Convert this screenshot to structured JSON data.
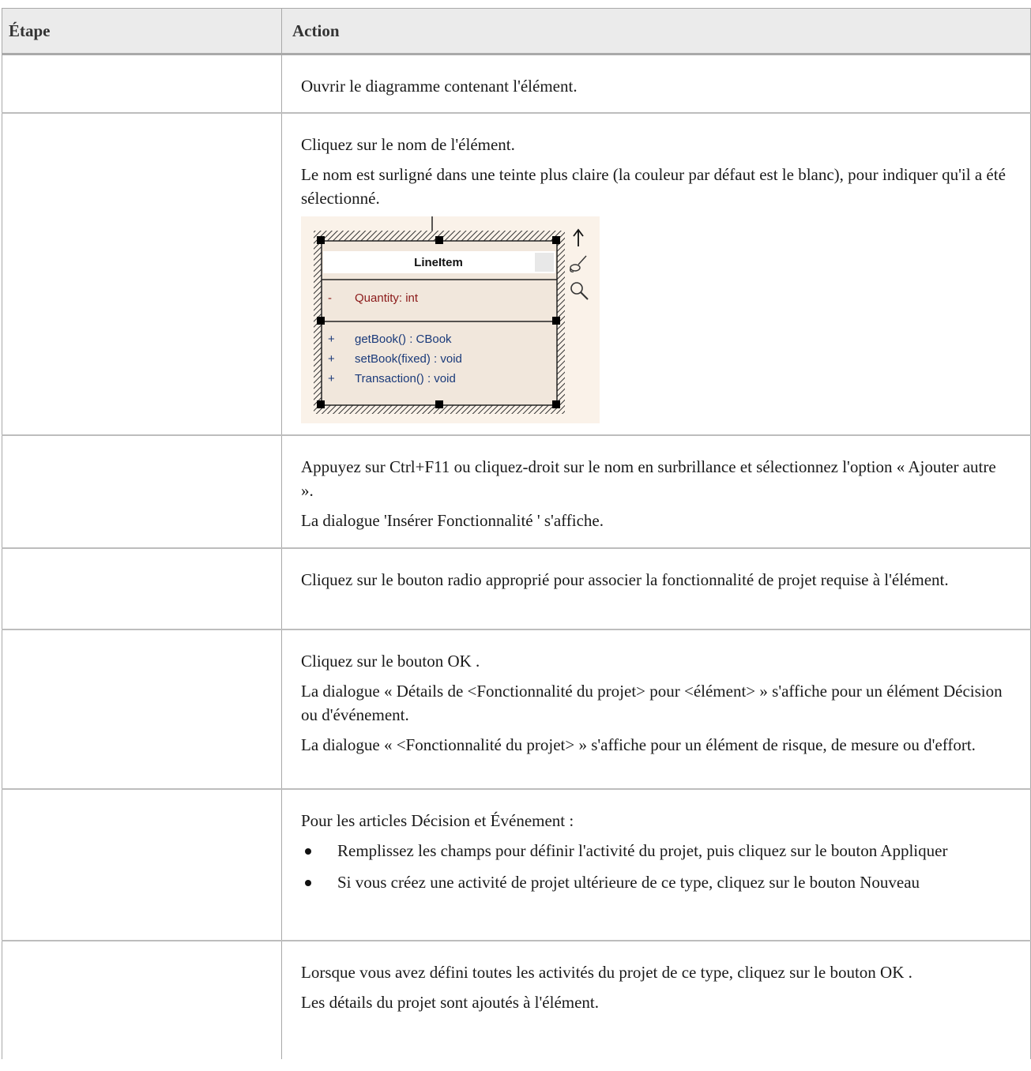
{
  "table": {
    "headers": {
      "step": "Étape",
      "action": "Action"
    },
    "rows": [
      {
        "step": "",
        "paragraphs": [
          "Ouvrir le diagramme contenant l'élément."
        ]
      },
      {
        "step": "",
        "paragraphs": [
          "Cliquez sur le nom de l'élément.",
          "Le nom est surligné dans une teinte plus claire (la couleur par défaut est le blanc), pour indiquer qu'il a été sélectionné."
        ],
        "diagram": {
          "class_name": "LineItem",
          "attribute_visibility": "-",
          "attribute": "Quantity: int",
          "operations": [
            {
              "visibility": "+",
              "text": "getBook() : CBook"
            },
            {
              "visibility": "+",
              "text": "setBook(fixed) : void"
            },
            {
              "visibility": "+",
              "text": "Transaction() : void"
            }
          ],
          "icons": [
            "arrow-up-icon",
            "paint-brush-icon",
            "magnifier-icon"
          ],
          "colors": {
            "background": "#faf2e9",
            "fill": "#f1e7dc",
            "attribute_text": "#8b1a1a",
            "operation_text": "#1a3a7a"
          }
        }
      },
      {
        "step": "",
        "paragraphs": [
          "Appuyez sur Ctrl+F11 ou cliquez-droit sur le nom en surbrillance et sélectionnez l'option « Ajouter autre ».",
          "La dialogue 'Insérer Fonctionnalité ' s'affiche."
        ]
      },
      {
        "step": "",
        "paragraphs": [
          "Cliquez sur le bouton radio approprié pour associer la fonctionnalité de projet requise à l'élément."
        ]
      },
      {
        "step": "",
        "paragraphs": [
          "Cliquez sur le bouton OK .",
          "La dialogue « Détails de <Fonctionnalité du projet> pour <élément> » s'affiche pour un élément Décision ou d'événement.",
          "La dialogue « <Fonctionnalité du projet> » s'affiche pour un élément de risque, de mesure ou d'effort."
        ]
      },
      {
        "step": "",
        "paragraphs": [
          "Pour les articles Décision et Événement :"
        ],
        "bullets": [
          "Remplissez les champs pour définir l'activité du projet, puis cliquez sur le bouton Appliquer",
          "Si vous créez une activité de projet ultérieure de ce type, cliquez sur le bouton Nouveau"
        ]
      },
      {
        "step": "",
        "paragraphs": [
          "Lorsque vous avez défini toutes les activités du projet de ce type, cliquez sur le bouton OK .",
          "Les détails du projet sont ajoutés à l'élément."
        ]
      }
    ]
  }
}
